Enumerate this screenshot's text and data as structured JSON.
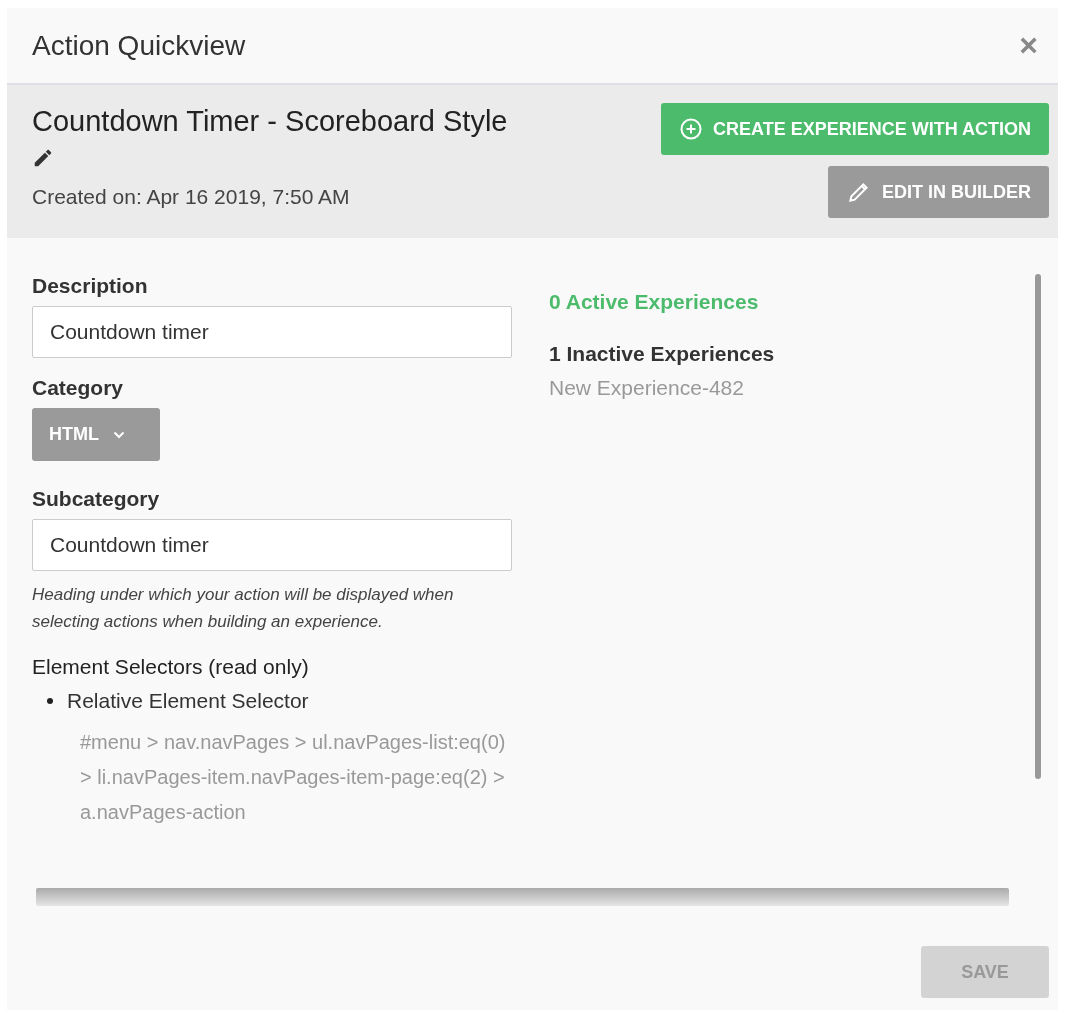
{
  "dialog": {
    "title": "Action Quickview",
    "close": "×"
  },
  "action": {
    "name": "Countdown Timer - Scoreboard Style",
    "created": "Created on: Apr 16 2019, 7:50 AM"
  },
  "buttons": {
    "create": "CREATE EXPERIENCE WITH ACTION",
    "edit": "EDIT IN BUILDER"
  },
  "form": {
    "description_label": "Description",
    "description_value": "Countdown timer",
    "category_label": "Category",
    "category_value": "HTML",
    "subcategory_label": "Subcategory",
    "subcategory_value": "Countdown timer",
    "subcategory_help": "Heading under which your action will be displayed when selecting actions when building an experience.",
    "selectors_heading": "Element Selectors (read only)",
    "selectors": [
      {
        "name": "Relative Element Selector",
        "value": "#menu > nav.navPages > ul.navPages-list:eq(0) > li.navPages-item.navPages-item-page:eq(2) > a.navPages-action"
      }
    ]
  },
  "experiences": {
    "active_heading": "0 Active Experiences",
    "inactive_heading": "1 Inactive Experiences",
    "inactive": [
      "New Experience-482"
    ]
  },
  "footer": {
    "save": {
      "label": "SAVE",
      "disabled": true
    }
  }
}
